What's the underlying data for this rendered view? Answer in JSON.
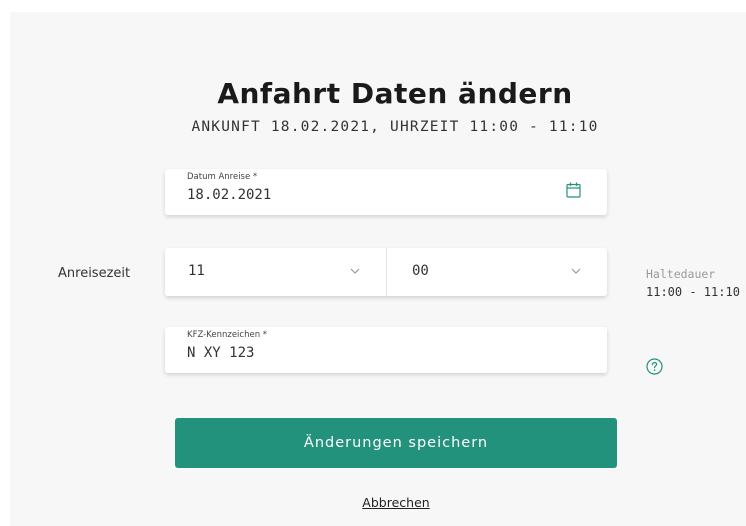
{
  "dialog": {
    "title": "Anfahrt Daten ändern",
    "subtitle": "ANKUNFT 18.02.2021, UHRZEIT 11:00 - 11:10",
    "close_glyph": "×"
  },
  "date_field": {
    "label": "Datum Anreise *",
    "value": "18.02.2021",
    "icon": "calendar-icon"
  },
  "arrival_time": {
    "label": "Anreisezeit",
    "hour": "11",
    "minute": "00",
    "icon": "chevron-down-icon"
  },
  "hold_duration": {
    "label": "Haltedauer",
    "value": "11:00 - 11:10"
  },
  "plate_field": {
    "label": "KFZ-Kennzeichen *",
    "value": "N XY 123",
    "help_icon": "help-icon"
  },
  "actions": {
    "save_label": "Änderungen speichern",
    "cancel_label": "Abbrechen"
  },
  "colors": {
    "accent": "#22927c",
    "modal_bg": "#f7f7f7",
    "field_bg": "#ffffff"
  }
}
